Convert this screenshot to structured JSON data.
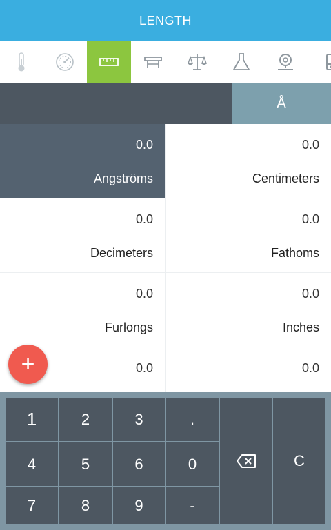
{
  "app": {
    "title": "LENGTH"
  },
  "tabs": [
    {
      "icon": "thermometer-icon",
      "active": false
    },
    {
      "icon": "speedometer-icon",
      "active": false
    },
    {
      "icon": "ruler-icon",
      "active": true
    },
    {
      "icon": "area-table-icon",
      "active": false
    },
    {
      "icon": "scale-balance-icon",
      "active": false
    },
    {
      "icon": "flask-icon",
      "active": false
    },
    {
      "icon": "pressure-gauge-icon",
      "active": false
    },
    {
      "icon": "storage-icon",
      "active": false
    }
  ],
  "input": {
    "value": "",
    "unit_symbol": "Å"
  },
  "units": [
    {
      "name": "Angströms",
      "value": "0.0",
      "selected": true
    },
    {
      "name": "Centimeters",
      "value": "0.0",
      "selected": false
    },
    {
      "name": "Decimeters",
      "value": "0.0",
      "selected": false
    },
    {
      "name": "Fathoms",
      "value": "0.0",
      "selected": false
    },
    {
      "name": "Furlongs",
      "value": "0.0",
      "selected": false
    },
    {
      "name": "Inches",
      "value": "0.0",
      "selected": false
    },
    {
      "name": "",
      "value": "0.0",
      "selected": false
    },
    {
      "name": "",
      "value": "0.0",
      "selected": false
    }
  ],
  "fab": {
    "label": "+"
  },
  "keypad": {
    "k1": "1",
    "k2": "2",
    "k3": "3",
    "dot": ".",
    "k4": "4",
    "k5": "5",
    "k6": "6",
    "k0": "0",
    "k7": "7",
    "k8": "8",
    "k9": "9",
    "minus": "-",
    "clear": "C"
  },
  "colors": {
    "appbar": "#3aaee0",
    "active_tab": "#8cc63f",
    "selected_cell": "#546270",
    "fab": "#f05a4f",
    "keypad_bg": "#7f96a3",
    "key": "#4d5761"
  }
}
